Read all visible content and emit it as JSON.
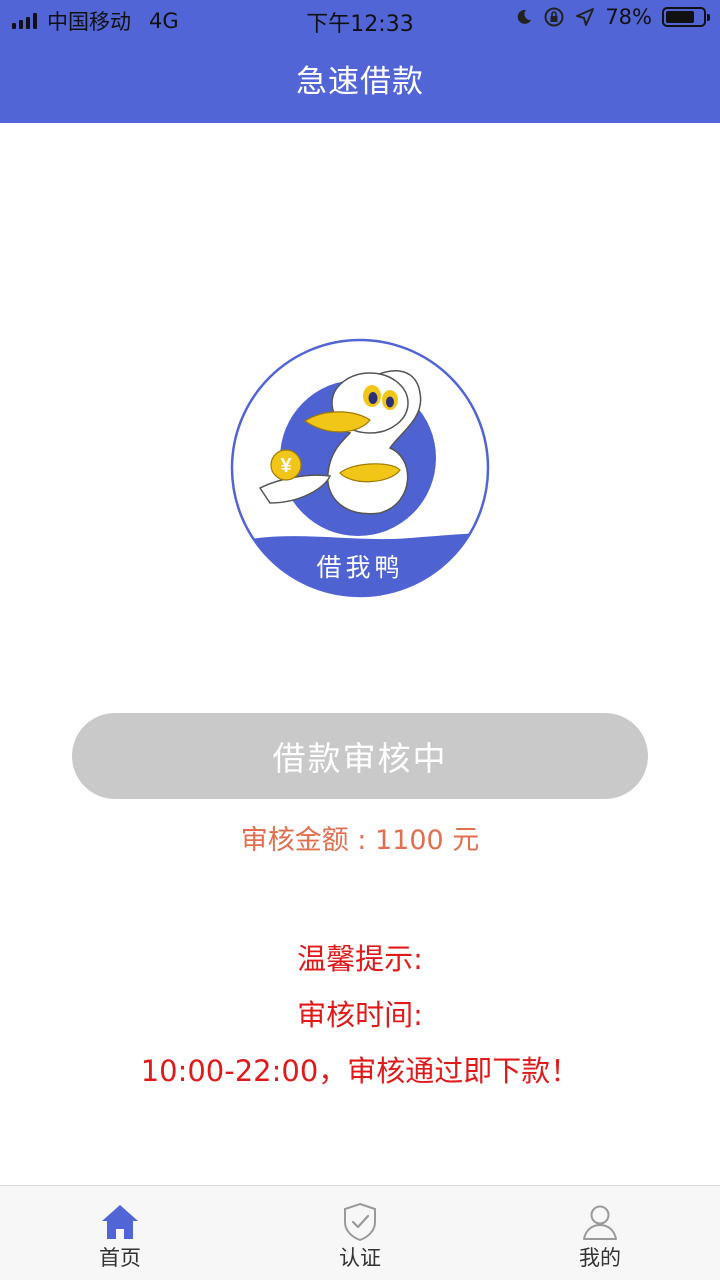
{
  "status_bar": {
    "carrier": "中国移动",
    "network": "4G",
    "time": "下午12:33",
    "battery_text": "78%",
    "battery_level": 0.78
  },
  "header": {
    "title": "急速借款"
  },
  "logo": {
    "text": "借我鸭",
    "coin_symbol": "¥"
  },
  "loan": {
    "status_label": "借款审核中",
    "amount_text": "审核金额 : 1100 元"
  },
  "tips": {
    "heading": "温馨提示:",
    "time_label": "审核时间:",
    "detail": "10:00-22:00，审核通过即下款！"
  },
  "tabbar": {
    "items": [
      {
        "label": "首页",
        "icon": "home-icon",
        "active": true
      },
      {
        "label": "认证",
        "icon": "shield-check-icon",
        "active": false
      },
      {
        "label": "我的",
        "icon": "user-icon",
        "active": false
      }
    ]
  },
  "colors": {
    "primary": "#5165d6",
    "button_disabled": "#c9c9c9",
    "amount_text": "#e26f4e",
    "tip_text": "#e01a1a",
    "tab_inactive": "#9a9a9a"
  }
}
